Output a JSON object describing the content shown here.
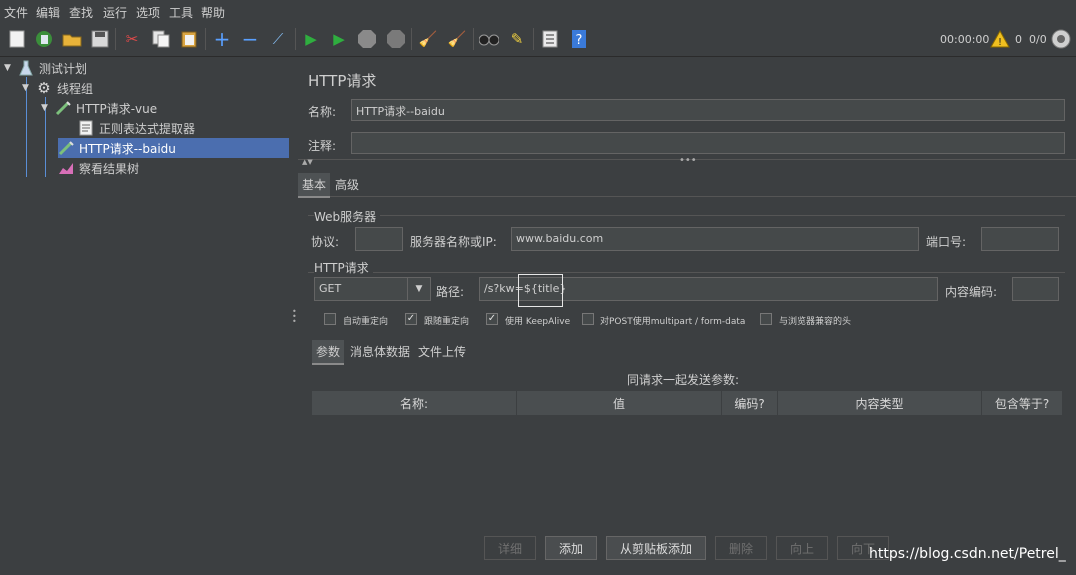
{
  "menu": [
    "文件",
    "编辑",
    "查找",
    "运行",
    "选项",
    "工具",
    "帮助"
  ],
  "toolbar": {
    "timer": "00:00:00",
    "warn_count": "0",
    "threads": "0/0",
    "colors": {
      "accent": "#4b6eaf",
      "background": "#3c3f41",
      "field": "#45494a"
    }
  },
  "tree": [
    {
      "label": "测试计划",
      "icon": "test-plan-flask-icon"
    },
    {
      "label": "线程组",
      "icon": "gear-icon"
    },
    {
      "label": "HTTP请求-vue",
      "icon": "pipette-icon"
    },
    {
      "label": "正则表达式提取器",
      "icon": "document-icon"
    },
    {
      "label": "HTTP请求--baidu",
      "icon": "pipette-icon",
      "selected": true
    },
    {
      "label": "察看结果树",
      "icon": "chart-icon"
    }
  ],
  "panel": {
    "title": "HTTP请求",
    "name_label": "名称:",
    "name_value": "HTTP请求--baidu",
    "comment_label": "注释:",
    "comment_value": "",
    "tabs": [
      "基本",
      "高级"
    ],
    "web_server": {
      "group_label": "Web服务器",
      "protocol_label": "协议:",
      "protocol_value": "",
      "server_label": "服务器名称或IP:",
      "server_value": "www.baidu.com",
      "port_label": "端口号:",
      "port_value": ""
    },
    "http_request": {
      "group_label": "HTTP请求",
      "method": "GET",
      "path_label": "路径:",
      "path_value": "/s?kw=${title}",
      "encoding_label": "内容编码:",
      "encoding_value": ""
    },
    "options": [
      {
        "label": "自动重定向",
        "checked": false
      },
      {
        "label": "跟随重定向",
        "checked": true
      },
      {
        "label": "使用 KeepAlive",
        "checked": true
      },
      {
        "label": "对POST使用multipart / form-data",
        "checked": false
      },
      {
        "label": "与浏览器兼容的头",
        "checked": false
      }
    ],
    "sub_tabs": [
      "参数",
      "消息体数据",
      "文件上传"
    ],
    "params_caption": "同请求一起发送参数:",
    "columns": [
      "名称:",
      "值",
      "编码?",
      "内容类型",
      "包含等于?"
    ],
    "buttons": [
      {
        "label": "详细",
        "enabled": false
      },
      {
        "label": "添加",
        "enabled": true
      },
      {
        "label": "从剪贴板添加",
        "enabled": true
      },
      {
        "label": "删除",
        "enabled": false
      },
      {
        "label": "向上",
        "enabled": false
      },
      {
        "label": "向下",
        "enabled": false
      }
    ]
  },
  "watermark": "https://blog.csdn.net/Petrel_"
}
